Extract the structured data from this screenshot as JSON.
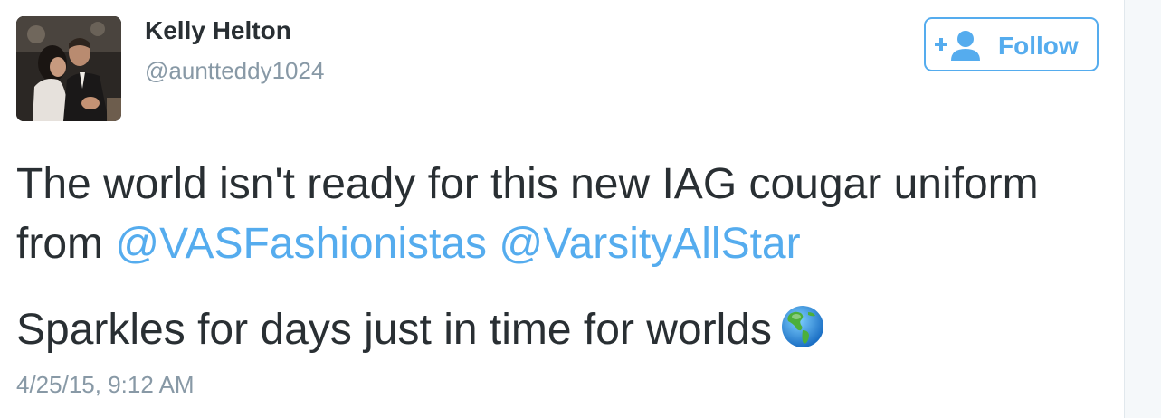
{
  "user": {
    "name": "Kelly Helton",
    "handle": "@auntteddy1024",
    "avatar_icon": "profile-photo"
  },
  "follow_button": {
    "label": "Follow",
    "icon": "add-user-icon",
    "color": "#55acee"
  },
  "tweet": {
    "line1": "The world isn't ready for this new IAG cougar uniform",
    "line2_prefix": "from ",
    "mentions": [
      "@VASFashionistas",
      "@VarsityAllStar"
    ],
    "line3": "Sparkles for days just in time for worlds",
    "emoji_icon": "earth-globe-americas-icon"
  },
  "timestamp": "4/25/15, 9:12 AM",
  "colors": {
    "text": "#292f33",
    "secondary": "#8899a6",
    "link": "#55acee"
  }
}
